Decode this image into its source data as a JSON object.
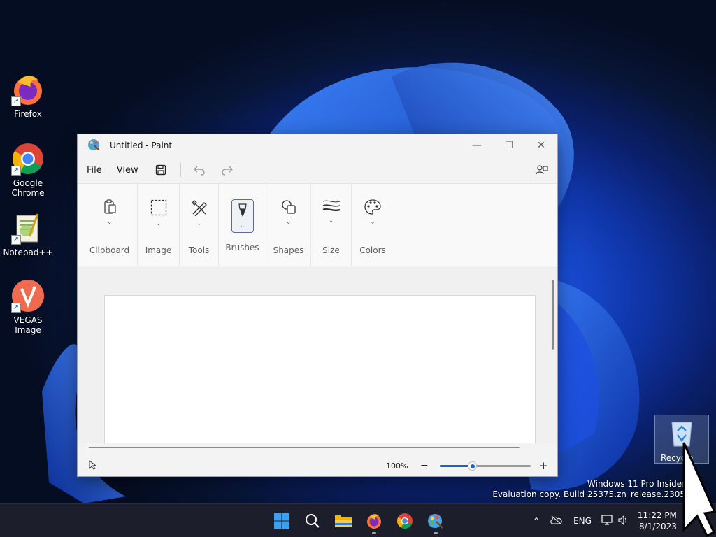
{
  "desktop": {
    "icons": [
      {
        "label": "Firefox"
      },
      {
        "label": "Google Chrome"
      },
      {
        "label": "Notepad++"
      },
      {
        "label": "VEGAS Image"
      }
    ],
    "recycle_bin_label": "Recycle",
    "watermark": {
      "line1": "Windows 11 Pro Insider",
      "line2": "Evaluation copy. Build 25375.zn_release.2305"
    }
  },
  "paint": {
    "title": "Untitled - Paint",
    "menu": [
      "File",
      "View"
    ],
    "ribbon_groups": [
      {
        "label": "Clipboard",
        "icon": "clipboard-icon"
      },
      {
        "label": "Image",
        "icon": "selection-icon"
      },
      {
        "label": "Tools",
        "icon": "tools-icon"
      },
      {
        "label": "Brushes",
        "icon": "brush-icon"
      },
      {
        "label": "Shapes",
        "icon": "shapes-icon"
      },
      {
        "label": "Size",
        "icon": "size-icon"
      },
      {
        "label": "Colors",
        "icon": "palette-icon"
      }
    ],
    "status": {
      "zoom": "100%",
      "zoom_level": 0.35
    }
  },
  "taskbar": {
    "apps": [
      "start-icon",
      "search-icon",
      "file-explorer-icon",
      "firefox-icon",
      "chrome-icon",
      "paint-icon"
    ],
    "language": "ENG",
    "time": "11:22 PM",
    "date": "8/1/2023"
  },
  "colors": {
    "accent": "#1a62c9",
    "taskbar": "#1c1f2b"
  }
}
